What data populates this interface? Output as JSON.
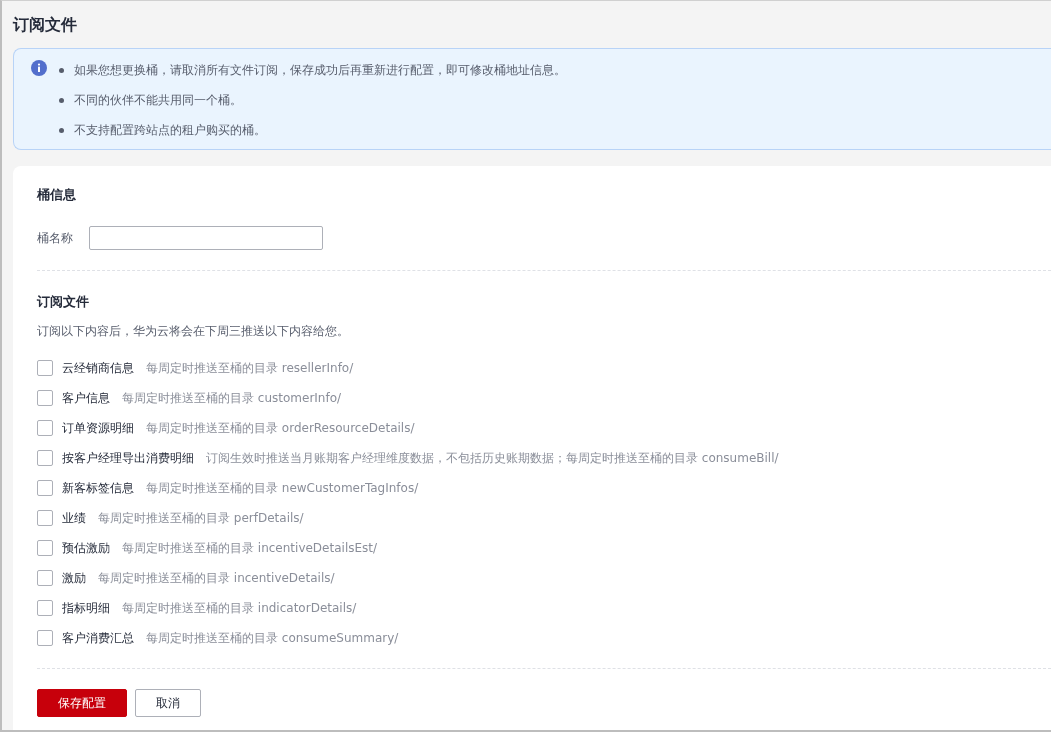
{
  "page_title": "订阅文件",
  "notice": {
    "items": [
      "如果您想更换桶，请取消所有文件订阅，保存成功后再重新进行配置，即可修改桶地址信息。",
      "不同的伙伴不能共用同一个桶。",
      "不支持配置跨站点的租户购买的桶。"
    ]
  },
  "bucket_section": {
    "title": "桶信息",
    "field_label": "桶名称"
  },
  "subscription_section": {
    "title": "订阅文件",
    "description": "订阅以下内容后，华为云将会在下周三推送以下内容给您。",
    "options": [
      {
        "label": "云经销商信息",
        "hint": "每周定时推送至桶的目录 resellerInfo/",
        "checked": false
      },
      {
        "label": "客户信息",
        "hint": "每周定时推送至桶的目录 customerInfo/",
        "checked": false
      },
      {
        "label": "订单资源明细",
        "hint": "每周定时推送至桶的目录 orderResourceDetails/",
        "checked": false
      },
      {
        "label": "按客户经理导出消费明细",
        "hint": "订阅生效时推送当月账期客户经理维度数据，不包括历史账期数据；每周定时推送至桶的目录 consumeBill/",
        "checked": false
      },
      {
        "label": "新客标签信息",
        "hint": "每周定时推送至桶的目录 newCustomerTagInfos/",
        "checked": false
      },
      {
        "label": "业绩",
        "hint": "每周定时推送至桶的目录 perfDetails/",
        "checked": false
      },
      {
        "label": "预估激励",
        "hint": "每周定时推送至桶的目录 incentiveDetailsEst/",
        "checked": false
      },
      {
        "label": "激励",
        "hint": "每周定时推送至桶的目录 incentiveDetails/",
        "checked": false
      },
      {
        "label": "指标明细",
        "hint": "每周定时推送至桶的目录 indicatorDetails/",
        "checked": false
      },
      {
        "label": "客户消费汇总",
        "hint": "每周定时推送至桶的目录 consumeSummary/",
        "checked": false
      }
    ]
  },
  "buttons": [
    {
      "label": "保存配置",
      "kind": "primary"
    },
    {
      "label": "取消",
      "kind": "secondary"
    }
  ]
}
